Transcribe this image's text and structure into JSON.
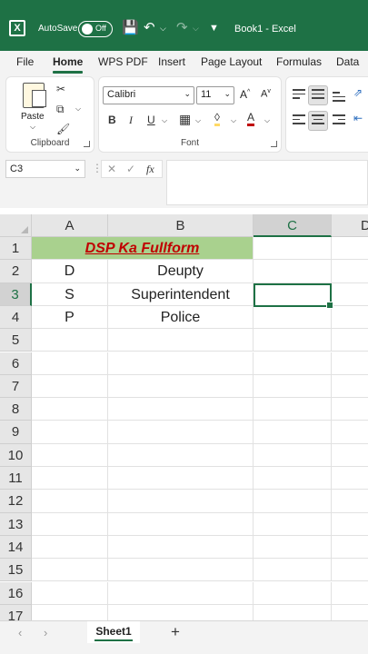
{
  "titlebar": {
    "autosave_label": "AutoSave",
    "autosave_state": "Off",
    "document_title": "Book1  -  Excel",
    "brand_color": "#1e7145"
  },
  "tabs": [
    "File",
    "Home",
    "WPS PDF",
    "Insert",
    "Page Layout",
    "Formulas",
    "Data"
  ],
  "active_tab": "Home",
  "ribbon": {
    "paste_label": "Paste",
    "clipboard_label": "Clipboard",
    "font_label": "Font",
    "font_name": "Calibri",
    "font_size": "11"
  },
  "formula_bar": {
    "name_box": "C3",
    "fx_label": "fx",
    "formula": ""
  },
  "sheet": {
    "columns": [
      "A",
      "B",
      "C",
      "D"
    ],
    "selected_column": "C",
    "rows": [
      "1",
      "2",
      "3",
      "4",
      "5",
      "6",
      "7",
      "8",
      "9",
      "10",
      "11",
      "12",
      "13",
      "14",
      "15",
      "16",
      "17"
    ],
    "selected_row": "3",
    "title_cell": "DSP Ka Fullform",
    "title_fill_color": "#a9d18e",
    "title_text_color": "#c00000",
    "data": [
      {
        "a": "D",
        "b": "Deupty"
      },
      {
        "a": "S",
        "b": "Superintendent"
      },
      {
        "a": "P",
        "b": "Police"
      }
    ]
  },
  "sheet_tabs": {
    "active": "Sheet1",
    "add_label": "+"
  }
}
